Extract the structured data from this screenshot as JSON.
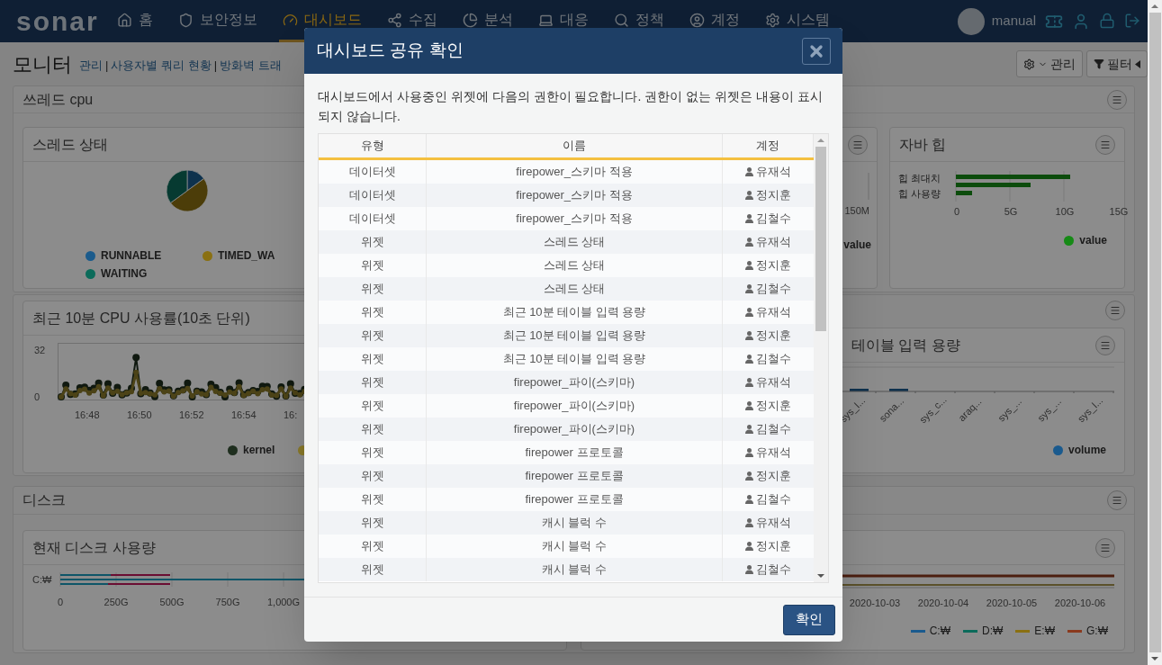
{
  "nav": {
    "logo": "sonar",
    "menu": [
      {
        "label": "홈",
        "selected": false
      },
      {
        "label": "보안정보",
        "selected": false
      },
      {
        "label": "대시보드",
        "selected": true
      },
      {
        "label": "수집",
        "selected": false
      },
      {
        "label": "분석",
        "selected": false
      },
      {
        "label": "대응",
        "selected": false
      },
      {
        "label": "정책",
        "selected": false
      },
      {
        "label": "계정",
        "selected": false
      },
      {
        "label": "시스템",
        "selected": false
      }
    ],
    "user": "manual"
  },
  "page": {
    "title": "모니터",
    "links": [
      "관리",
      "사용자별 쿼리 현황",
      "방화벽 트래"
    ],
    "separator": "|",
    "buttons": [
      "관리",
      "필터"
    ]
  },
  "thread_section": {
    "title": "쓰레드 cpu",
    "thread_card": {
      "title": "스레드 상태",
      "legend": [
        {
          "label": "RUNNABLE",
          "color": "#1b5b8c"
        },
        {
          "label": "TIMED_WA",
          "color": "#8a7012"
        },
        {
          "label": "WAITING",
          "color": "#0b6b5a"
        }
      ]
    },
    "middle_card": {
      "axis_label": "150M",
      "legend": "value"
    },
    "heap_card": {
      "title": "자바 힙",
      "categories": [
        "힙 최대치",
        "힙 사용량"
      ],
      "xticks": [
        "0",
        "5G",
        "10G",
        "15G"
      ],
      "legend": {
        "label": "value",
        "color": "#168a16"
      }
    }
  },
  "cpu_section": {
    "cpu_card": {
      "title": "최근 10분 CPU 사용률(10초 단위)",
      "yticks": [
        "32",
        "0"
      ],
      "xticks": [
        "16:48",
        "16:50",
        "16:52",
        "16:54",
        "16:"
      ],
      "legend": [
        {
          "label": "kernel",
          "color": "#1e2e1e"
        },
        {
          "color": "#8a7a2a"
        }
      ]
    },
    "table_card": {
      "title": "테이블 입력 용량",
      "xlabels": [
        "sys_l...",
        "sona...",
        "sys_c...",
        "araq...",
        "sys_...",
        "sys_...",
        "sys_l..."
      ],
      "legend": {
        "label": "volume",
        "color": "#1a5a8e"
      }
    }
  },
  "disk_section": {
    "title": "디스크",
    "disk_card": {
      "title": "현재 디스크 사용량",
      "category": "C:₩",
      "xticks": [
        "0",
        "250G",
        "500G",
        "750G",
        "1,000G"
      ]
    },
    "trend_card": {
      "dates": [
        "2020-10-03",
        "2020-10-04",
        "2020-10-05",
        "2020-10-06"
      ],
      "legend": [
        {
          "label": "C:₩",
          "color": "#1a5a8e"
        },
        {
          "label": "D:₩",
          "color": "#0b6b5a"
        },
        {
          "label": "E:₩",
          "color": "#8a7012"
        },
        {
          "label": "G:₩",
          "color": "#8a3a1e"
        }
      ]
    }
  },
  "dialog": {
    "title": "대시보드 공유 확인",
    "message": "대시보드에서 사용중인 위젯에 다음의 권한이 필요합니다. 권한이 없는 위젯은 내용이 표시되지 않습니다.",
    "columns": [
      "유형",
      "이름",
      "계정"
    ],
    "rows": [
      {
        "type": "데이터셋",
        "name": "firepower_스키마 적용",
        "account": "유재석"
      },
      {
        "type": "데이터셋",
        "name": "firepower_스키마 적용",
        "account": "정지훈"
      },
      {
        "type": "데이터셋",
        "name": "firepower_스키마 적용",
        "account": "김철수"
      },
      {
        "type": "위젯",
        "name": "스레드 상태",
        "account": "유재석"
      },
      {
        "type": "위젯",
        "name": "스레드 상태",
        "account": "정지훈"
      },
      {
        "type": "위젯",
        "name": "스레드 상태",
        "account": "김철수"
      },
      {
        "type": "위젯",
        "name": "최근 10분 테이블 입력 용량",
        "account": "유재석"
      },
      {
        "type": "위젯",
        "name": "최근 10분 테이블 입력 용량",
        "account": "정지훈"
      },
      {
        "type": "위젯",
        "name": "최근 10분 테이블 입력 용량",
        "account": "김철수"
      },
      {
        "type": "위젯",
        "name": "firepower_파이(스키마)",
        "account": "유재석"
      },
      {
        "type": "위젯",
        "name": "firepower_파이(스키마)",
        "account": "정지훈"
      },
      {
        "type": "위젯",
        "name": "firepower_파이(스키마)",
        "account": "김철수"
      },
      {
        "type": "위젯",
        "name": "firepower 프로토콜",
        "account": "유재석"
      },
      {
        "type": "위젯",
        "name": "firepower 프로토콜",
        "account": "정지훈"
      },
      {
        "type": "위젯",
        "name": "firepower 프로토콜",
        "account": "김철수"
      },
      {
        "type": "위젯",
        "name": "캐시 블럭 수",
        "account": "유재석"
      },
      {
        "type": "위젯",
        "name": "캐시 블럭 수",
        "account": "정지훈"
      },
      {
        "type": "위젯",
        "name": "캐시 블럭 수",
        "account": "김철수"
      }
    ],
    "confirm": "확인"
  }
}
